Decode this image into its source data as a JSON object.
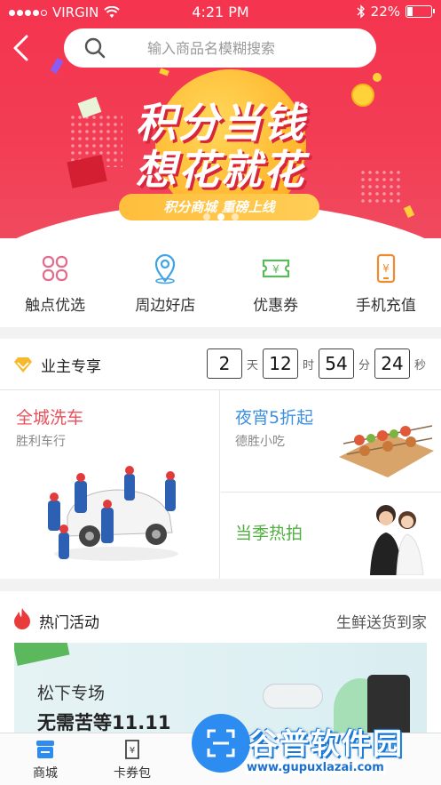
{
  "status_bar": {
    "carrier": "VIRGIN",
    "time": "4:21 PM",
    "battery": "22%",
    "battery_level": 0.22
  },
  "search": {
    "placeholder": "输入商品名模糊搜索"
  },
  "banner": {
    "headline_1": "积分当钱",
    "headline_2": "想花就花",
    "subtitle": "积分商城  重磅上线",
    "page_count": 3,
    "active_page": 1
  },
  "quick_entries": [
    {
      "label": "触点优选",
      "icon": "clover-icon"
    },
    {
      "label": "周边好店",
      "icon": "location-pin-icon"
    },
    {
      "label": "优惠券",
      "icon": "coupon-icon"
    },
    {
      "label": "手机充值",
      "icon": "phone-recharge-icon"
    }
  ],
  "member": {
    "title": "业主专享",
    "countdown": {
      "days": "2",
      "days_unit": "天",
      "hours": "12",
      "hours_unit": "时",
      "minutes": "54",
      "minutes_unit": "分",
      "seconds": "24",
      "seconds_unit": "秒"
    },
    "deals": [
      {
        "title": "全城洗车",
        "subtitle": "胜利车行",
        "color": "#e8505b"
      },
      {
        "title": "夜宵5折起",
        "subtitle": "德胜小吃",
        "color": "#3d8fe0"
      },
      {
        "title": "当季热拍",
        "subtitle": "",
        "color": "#52b043"
      }
    ]
  },
  "hot": {
    "title": "热门活动",
    "more": "生鲜送货到家",
    "promo_line_1": "松下专场",
    "promo_line_2": "无需苦等11.11"
  },
  "tabbar": {
    "tabs": [
      {
        "label": "商城"
      },
      {
        "label": "卡券包"
      }
    ]
  },
  "watermark": {
    "brand": "谷普软件园",
    "url": "www.gupuxlazai.com"
  },
  "colors": {
    "brand_red": "#f5344f",
    "accent_blue": "#2d8cf0",
    "gold": "#ffb72e"
  }
}
